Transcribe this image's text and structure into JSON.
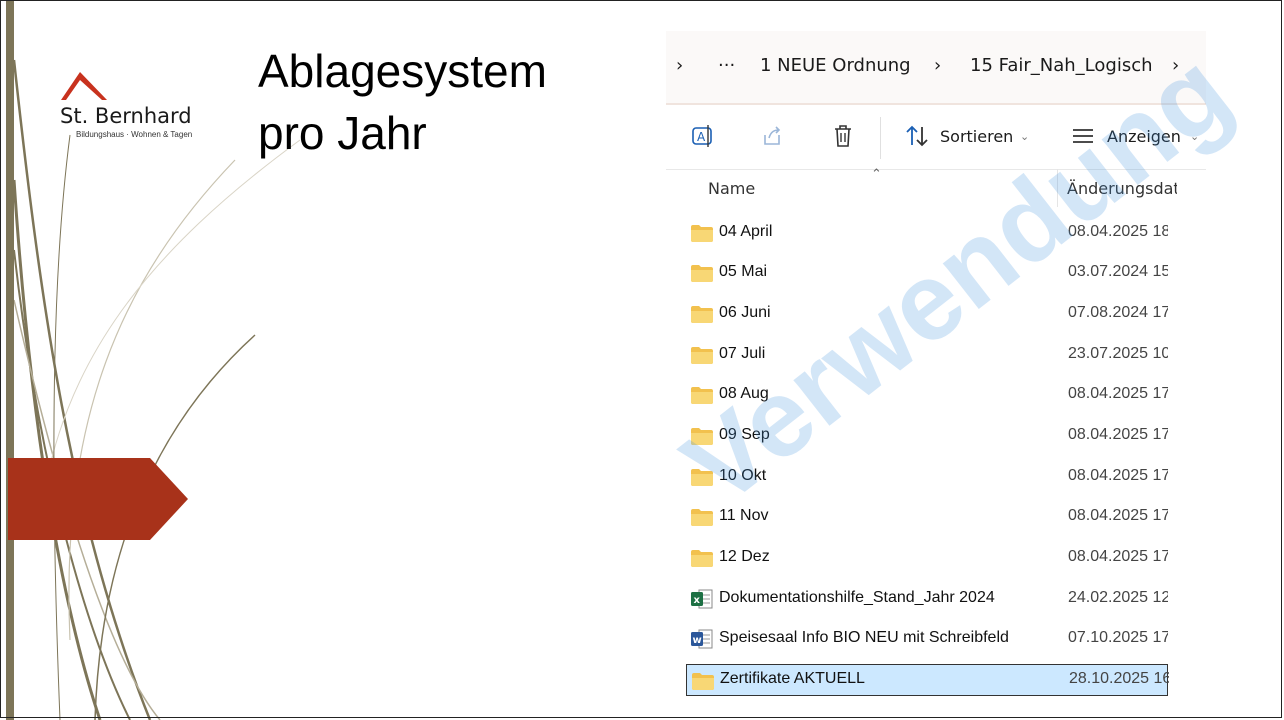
{
  "slide": {
    "title_line1": "Ablagesystem",
    "title_line2": "pro Jahr",
    "logo_name": "St. Bernhard",
    "logo_subtitle": "Bildungshaus · Wohnen & Tagen",
    "accent_red": "#a8321a",
    "bar_color": "#7d7558",
    "watermark": "Verwendung"
  },
  "explorer": {
    "breadcrumb": {
      "chevron_icon": "chevron-right-icon",
      "more": "···",
      "items": [
        "1 NEUE Ordnung",
        "15 Fair_Nah_Logisch"
      ]
    },
    "toolbar": {
      "sort_label": "Sortieren",
      "view_label": "Anzeigen",
      "icons": [
        "rename-icon",
        "share-icon",
        "delete-icon",
        "sort-icon",
        "view-icon"
      ]
    },
    "columns": {
      "name": "Name",
      "modified": "Änderungsdatum"
    },
    "rows": [
      {
        "name": "04 April",
        "date": "08.04.2025 18:",
        "type": "folder",
        "selected": false
      },
      {
        "name": "05 Mai",
        "date": "03.07.2024 15:",
        "type": "folder",
        "selected": false
      },
      {
        "name": "06 Juni",
        "date": "07.08.2024 17:",
        "type": "folder",
        "selected": false
      },
      {
        "name": "07 Juli",
        "date": "23.07.2025 10:",
        "type": "folder",
        "selected": false
      },
      {
        "name": "08 Aug",
        "date": "08.04.2025 17:",
        "type": "folder",
        "selected": false
      },
      {
        "name": "09 Sep",
        "date": "08.04.2025 17:",
        "type": "folder",
        "selected": false
      },
      {
        "name": "10 Okt",
        "date": "08.04.2025 17:",
        "type": "folder",
        "selected": false
      },
      {
        "name": "11 Nov",
        "date": "08.04.2025 17:",
        "type": "folder",
        "selected": false
      },
      {
        "name": "12 Dez",
        "date": "08.04.2025 17:",
        "type": "folder",
        "selected": false
      },
      {
        "name": "Dokumentationshilfe_Stand_Jahr 2024",
        "date": "24.02.2025 12:",
        "type": "excel",
        "selected": false
      },
      {
        "name": "Speisesaal Info BIO NEU mit Schreibfeld",
        "date": "07.10.2025 17:",
        "type": "word",
        "selected": false
      },
      {
        "name": "Zertifikate AKTUELL",
        "date": "28.10.2025 16:",
        "type": "folder",
        "selected": true
      }
    ]
  }
}
